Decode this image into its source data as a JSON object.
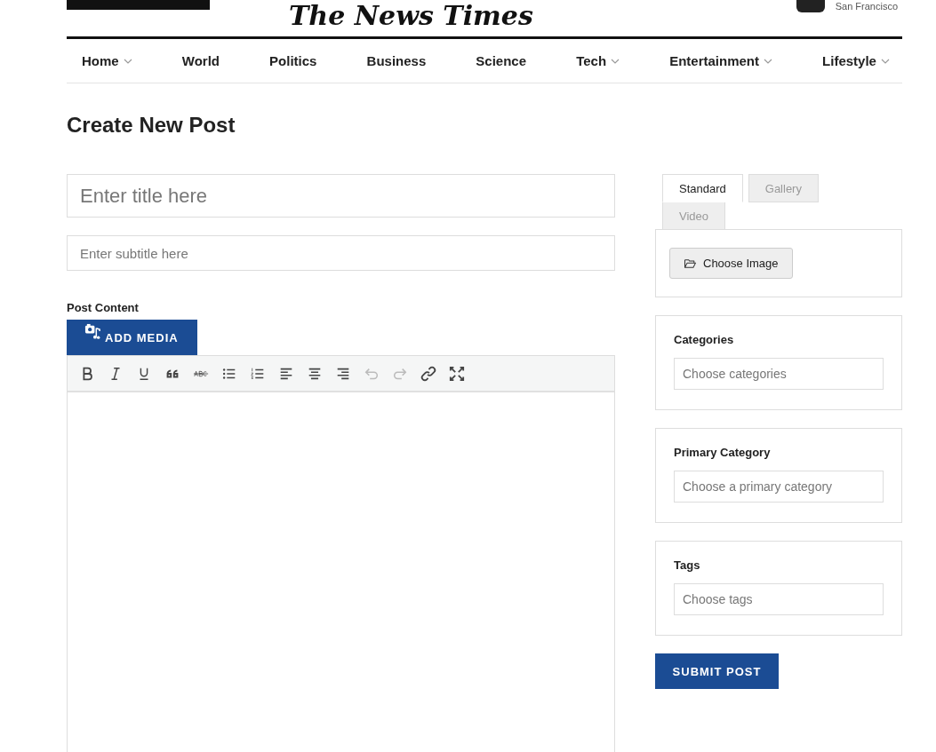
{
  "masthead": {
    "title": "The News Times",
    "location": "San Francisco"
  },
  "nav": [
    {
      "label": "Home",
      "dropdown": true
    },
    {
      "label": "World",
      "dropdown": false
    },
    {
      "label": "Politics",
      "dropdown": false
    },
    {
      "label": "Business",
      "dropdown": false
    },
    {
      "label": "Science",
      "dropdown": false
    },
    {
      "label": "Tech",
      "dropdown": true
    },
    {
      "label": "Entertainment",
      "dropdown": true
    },
    {
      "label": "Lifestyle",
      "dropdown": true
    }
  ],
  "page_title": "Create New Post",
  "title_field": {
    "placeholder": "Enter title here"
  },
  "subtitle_field": {
    "placeholder": "Enter subtitle here"
  },
  "content_label": "Post Content",
  "add_media_button": "ADD MEDIA",
  "toolbar": [
    {
      "kind": "bold",
      "disabled": false
    },
    {
      "kind": "italic",
      "disabled": false
    },
    {
      "kind": "underline",
      "disabled": false
    },
    {
      "kind": "quote",
      "disabled": false
    },
    {
      "kind": "strike",
      "disabled": false
    },
    {
      "kind": "bullets",
      "disabled": false
    },
    {
      "kind": "numbers",
      "disabled": false
    },
    {
      "kind": "align-left",
      "disabled": false
    },
    {
      "kind": "align-center",
      "disabled": false
    },
    {
      "kind": "align-right",
      "disabled": false
    },
    {
      "kind": "undo",
      "disabled": true
    },
    {
      "kind": "redo",
      "disabled": true
    },
    {
      "kind": "link",
      "disabled": false
    },
    {
      "kind": "fullscreen",
      "disabled": false
    }
  ],
  "format_tabs": [
    {
      "label": "Standard",
      "selected": true
    },
    {
      "label": "Gallery",
      "selected": false
    },
    {
      "label": "Video",
      "selected": false
    }
  ],
  "choose_image_button": "Choose Image",
  "panels": [
    {
      "label": "Categories",
      "placeholder": "Choose categories"
    },
    {
      "label": "Primary Category",
      "placeholder": "Choose a primary category"
    },
    {
      "label": "Tags",
      "placeholder": "Choose tags"
    }
  ],
  "submit_button": "SUBMIT POST"
}
